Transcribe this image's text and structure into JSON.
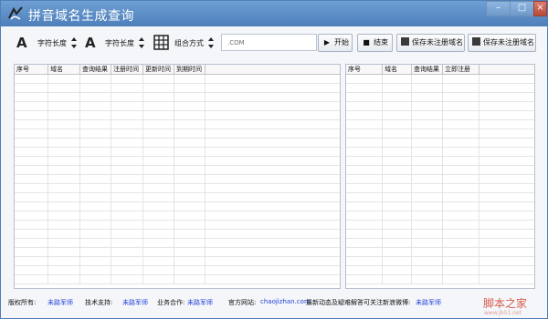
{
  "window": {
    "title": "拼音域名生成查询",
    "controls": [
      "–",
      "□",
      "×"
    ]
  },
  "toolbar": {
    "length1_label": "字符长度",
    "length2_label": "字符长度",
    "combo_label": "组合方式",
    "domain_suffix": ".COM",
    "start_label": "开始",
    "stop_label": "结束",
    "save1_label": "保存未注册域名",
    "save2_label": "保存未注册域名"
  },
  "left_grid": {
    "columns": [
      "序号",
      "域名",
      "查询结果",
      "注册时间",
      "更新时间",
      "到期时间"
    ]
  },
  "right_grid": {
    "columns": [
      "序号",
      "域名",
      "查询结果",
      "立即注册"
    ]
  },
  "status": {
    "copyright_label": "版权所有:",
    "copyright_value": "未路军师",
    "support_label": "技术支持:",
    "support_value": "未路军师",
    "business_label": "业务合作:",
    "business_value": "未路军师",
    "website_label": "官方网站:",
    "website_value": "chaojizhan.com",
    "weibo_label": "最新动态及疑难解答可关注新浪微博:",
    "weibo_value": "未路军师"
  },
  "watermark": {
    "brand": "脚本之家",
    "url": "www.jb51.net"
  }
}
